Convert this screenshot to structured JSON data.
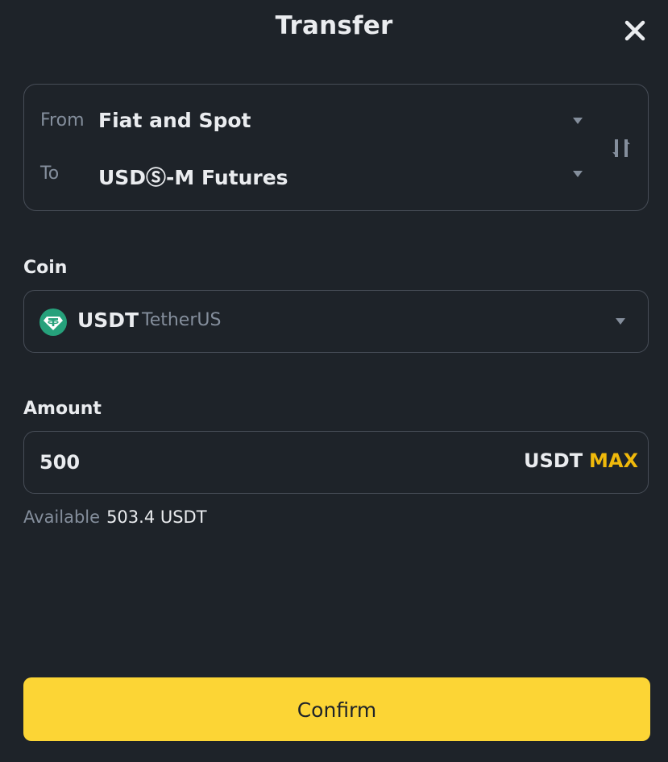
{
  "dialog": {
    "title": "Transfer"
  },
  "route": {
    "from_label": "From",
    "from_value": "Fiat and Spot",
    "to_label": "To",
    "to_value": "USDⓈ-M Futures"
  },
  "coin": {
    "label": "Coin",
    "symbol": "USDT",
    "name": "TetherUS",
    "logo_color": "#26a17b"
  },
  "amount": {
    "label": "Amount",
    "value": "500",
    "unit": "USDT",
    "max_label": "MAX"
  },
  "available": {
    "label": "Available",
    "value": "503.4 USDT"
  },
  "confirm": {
    "label": "Confirm"
  },
  "colors": {
    "background": "#1e2329",
    "accent": "#fcd535",
    "max": "#f0b90b",
    "muted_text": "#848e9c",
    "border": "#474d57"
  },
  "icons": [
    "close-icon",
    "swap-icon",
    "chevron-down-icon",
    "usdt-logo-icon"
  ]
}
